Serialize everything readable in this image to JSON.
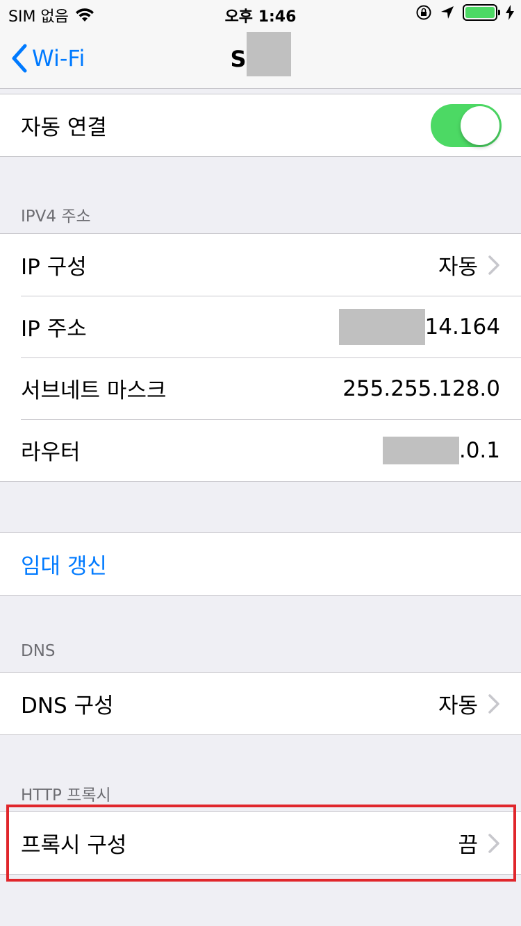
{
  "status_bar": {
    "carrier": "SIM 없음",
    "time": "오후 1:46",
    "battery_color": "#4cd964",
    "icons": [
      "wifi-icon",
      "rotation-lock-icon",
      "location-arrow-icon",
      "battery-icon",
      "charging-bolt-icon"
    ]
  },
  "nav": {
    "back_label": "Wi-Fi",
    "title": "S"
  },
  "auto_join": {
    "label": "자동 연결",
    "on": true
  },
  "ipv4": {
    "header": "IPV4 주소",
    "rows": [
      {
        "label": "IP 구성",
        "value": "자동"
      },
      {
        "label": "IP 주소",
        "value": "14.164"
      },
      {
        "label": "서브네트 마스크",
        "value": "255.255.128.0"
      },
      {
        "label": "라우터",
        "value": ".0.1"
      }
    ]
  },
  "lease": {
    "label": "임대 갱신"
  },
  "dns": {
    "header": "DNS",
    "label": "DNS 구성",
    "value": "자동"
  },
  "http_proxy": {
    "header": "HTTP 프록시",
    "label": "프록시 구성",
    "value": "끔"
  },
  "colors": {
    "accent": "#007aff",
    "toggle_on": "#4cd964",
    "highlight": "#e0262b",
    "background": "#efeff4"
  }
}
